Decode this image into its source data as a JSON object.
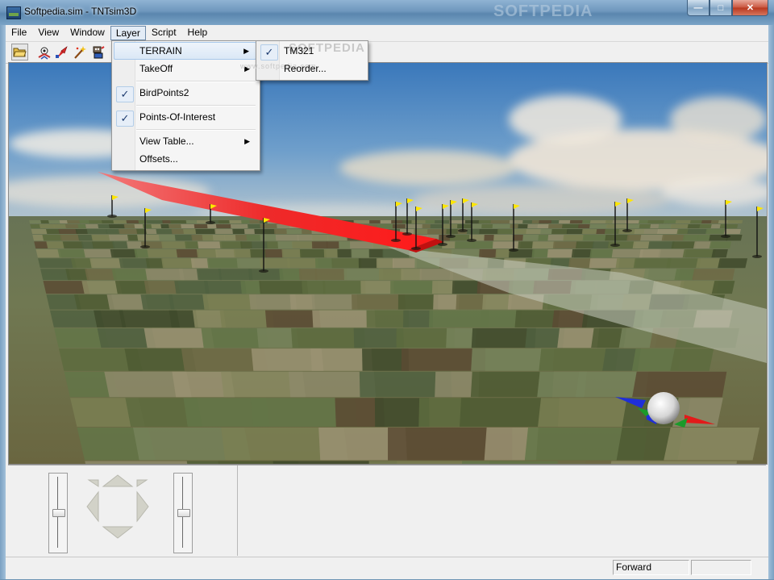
{
  "window": {
    "title": "Softpedia.sim - TNTsim3D",
    "watermark": "SOFTPEDIA",
    "buttons": {
      "minimize": "—",
      "maximize": "□",
      "close": "✕"
    }
  },
  "menubar": {
    "items": [
      {
        "label": "File"
      },
      {
        "label": "View"
      },
      {
        "label": "Window"
      },
      {
        "label": "Layer"
      },
      {
        "label": "Script"
      },
      {
        "label": "Help"
      }
    ]
  },
  "toolbar": {
    "buttons": [
      {
        "icon": "open-folder-icon"
      },
      {
        "icon": "viewer-icon"
      },
      {
        "icon": "rocket-icon"
      },
      {
        "icon": "wand-icon"
      },
      {
        "icon": "robot-icon"
      }
    ]
  },
  "layer_menu": {
    "items": [
      {
        "label": "TERRAIN",
        "checked": false,
        "submenu": true,
        "highlighted": true
      },
      {
        "label": "TakeOff",
        "checked": false,
        "submenu": true
      },
      {
        "label": "BirdPoints2",
        "checked": true,
        "submenu": false
      },
      {
        "label": "Points-Of-Interest",
        "checked": true,
        "submenu": false
      },
      {
        "label": "View Table...",
        "checked": false,
        "submenu": true
      },
      {
        "label": "Offsets...",
        "checked": false,
        "submenu": false
      }
    ]
  },
  "terrain_submenu": {
    "items": [
      {
        "label": "TM321",
        "checked": true
      },
      {
        "label": "Reorder...",
        "checked": false
      }
    ],
    "watermark": "SOFTPEDIA",
    "watermark_sub": "www.softpedia.com"
  },
  "check_glyph": "✓",
  "submenu_arrow": "▶",
  "statusbar": {
    "mode": "Forward",
    "extra": ""
  },
  "colors": {
    "flight_path": "#f01e1e",
    "flag": "#ffe600",
    "sky_top": "#3f7cbd",
    "ground": "#6f7a4e"
  }
}
